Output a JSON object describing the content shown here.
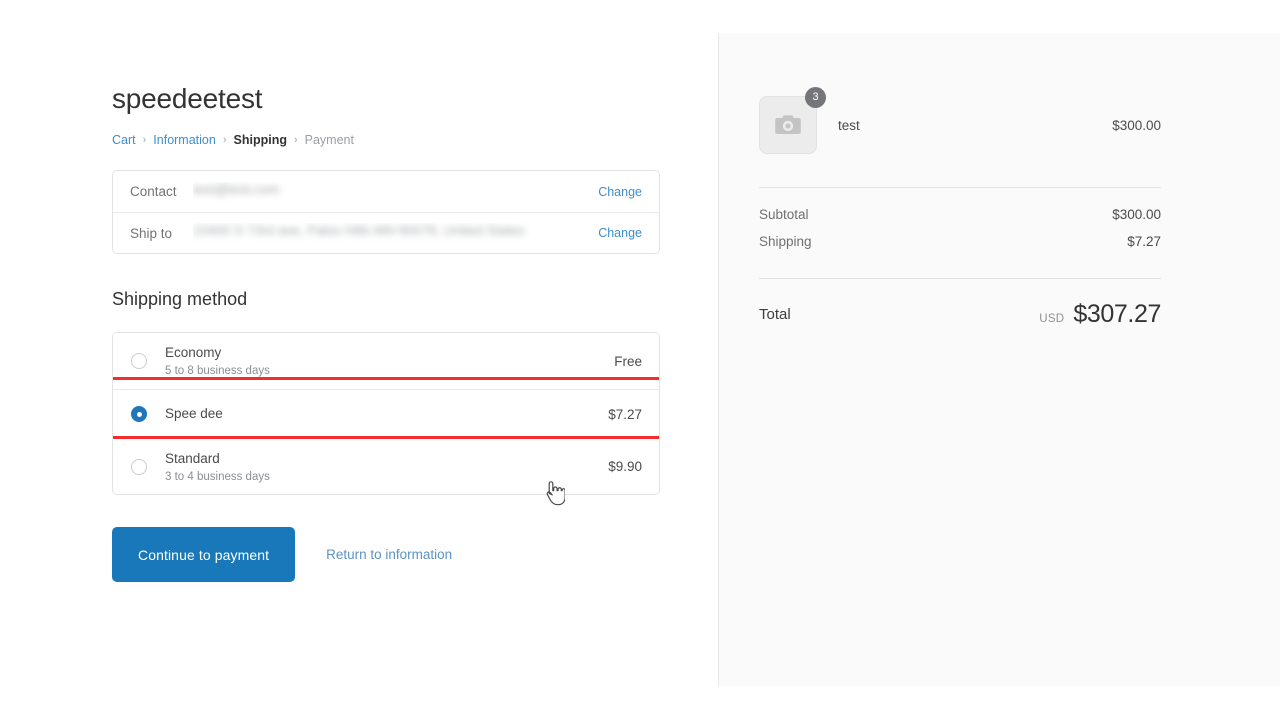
{
  "store": {
    "title": "speedeetest"
  },
  "breadcrumb": {
    "separator": "›",
    "items": [
      {
        "label": "Cart",
        "state": "link"
      },
      {
        "label": "Information",
        "state": "link"
      },
      {
        "label": "Shipping",
        "state": "current"
      },
      {
        "label": "Payment",
        "state": "upcoming"
      }
    ]
  },
  "review": {
    "change_label": "Change",
    "rows": [
      {
        "label": "Contact",
        "value": "test@test.com",
        "redacted": true
      },
      {
        "label": "Ship to",
        "value": "10400 S 73rd ave, Palos Hills MN 60078, United States",
        "redacted": true
      }
    ]
  },
  "shipping": {
    "section_title": "Shipping method",
    "options": [
      {
        "name": "Economy",
        "eta": "5 to 8 business days",
        "price": "Free",
        "selected": false
      },
      {
        "name": "Spee dee",
        "eta": "",
        "price": "$7.27",
        "selected": true
      },
      {
        "name": "Standard",
        "eta": "3 to 4 business days",
        "price": "$9.90",
        "selected": false
      }
    ]
  },
  "actions": {
    "primary_label": "Continue to payment",
    "secondary_label": "Return to information"
  },
  "summary": {
    "line_items": [
      {
        "name": "test",
        "quantity": "3",
        "price": "$300.00",
        "thumb_icon": "camera-placeholder-icon"
      }
    ],
    "totals": [
      {
        "label": "Subtotal",
        "value": "$300.00"
      },
      {
        "label": "Shipping",
        "value": "$7.27"
      }
    ],
    "grand_total": {
      "label": "Total",
      "currency": "USD",
      "value": "$307.27"
    }
  },
  "annotation": {
    "type": "highlight-rectangle",
    "color": "#f52c2c",
    "targets": "shipping-option-spee-dee"
  },
  "colors": {
    "accent_blue": "#1878b9",
    "link_blue": "#3d8ecc",
    "radio_selected": "#1f76bd",
    "panel_background": "#fafafa",
    "annotation_red": "#f52c2c",
    "badge_gray": "#74767a"
  },
  "cursor": {
    "type": "pointer-hand-cursor"
  }
}
